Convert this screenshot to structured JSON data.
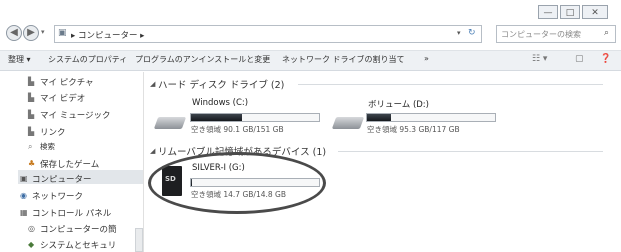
{
  "window": {
    "min_label": "—",
    "max_label": "□",
    "close_label": "✕"
  },
  "address": {
    "path": "▸ コンピューター ▸",
    "refresh_label": "↻"
  },
  "search": {
    "placeholder": "コンピューターの検索"
  },
  "toolbar": {
    "organize": "整理 ▾",
    "system_properties": "システムのプロパティ",
    "uninstall": "プログラムのアンインストールと変更",
    "map_drive": "ネットワーク ドライブの割り当て",
    "more": "»"
  },
  "sidebar": {
    "items": [
      {
        "label": "マイ ピクチャ"
      },
      {
        "label": "マイ ビデオ"
      },
      {
        "label": "マイ ミュージック"
      },
      {
        "label": "リンク"
      },
      {
        "label": "検索"
      },
      {
        "label": "保存したゲーム"
      },
      {
        "label": "コンピューター"
      },
      {
        "label": "ネットワーク"
      },
      {
        "label": "コントロール パネル"
      },
      {
        "label": "コンピューターの簡"
      },
      {
        "label": "システムとセキュリ"
      }
    ]
  },
  "main": {
    "hdd_section": "ハード ディスク ドライブ (2)",
    "removable_section": "リムーバブル記憶域があるデバイス (1)",
    "drives": [
      {
        "name": "Windows (C:)",
        "free_text": "空き領域 90.1 GB/151 GB",
        "used_fraction": 0.4
      },
      {
        "name": "ボリューム (D:)",
        "free_text": "空き領域 95.3 GB/117 GB",
        "used_fraction": 0.19
      },
      {
        "name": "SILVER-I (G:)",
        "free_text": "空き領域 14.7 GB/14.8 GB",
        "used_fraction": 0.01
      }
    ],
    "sd_label": "SD"
  }
}
